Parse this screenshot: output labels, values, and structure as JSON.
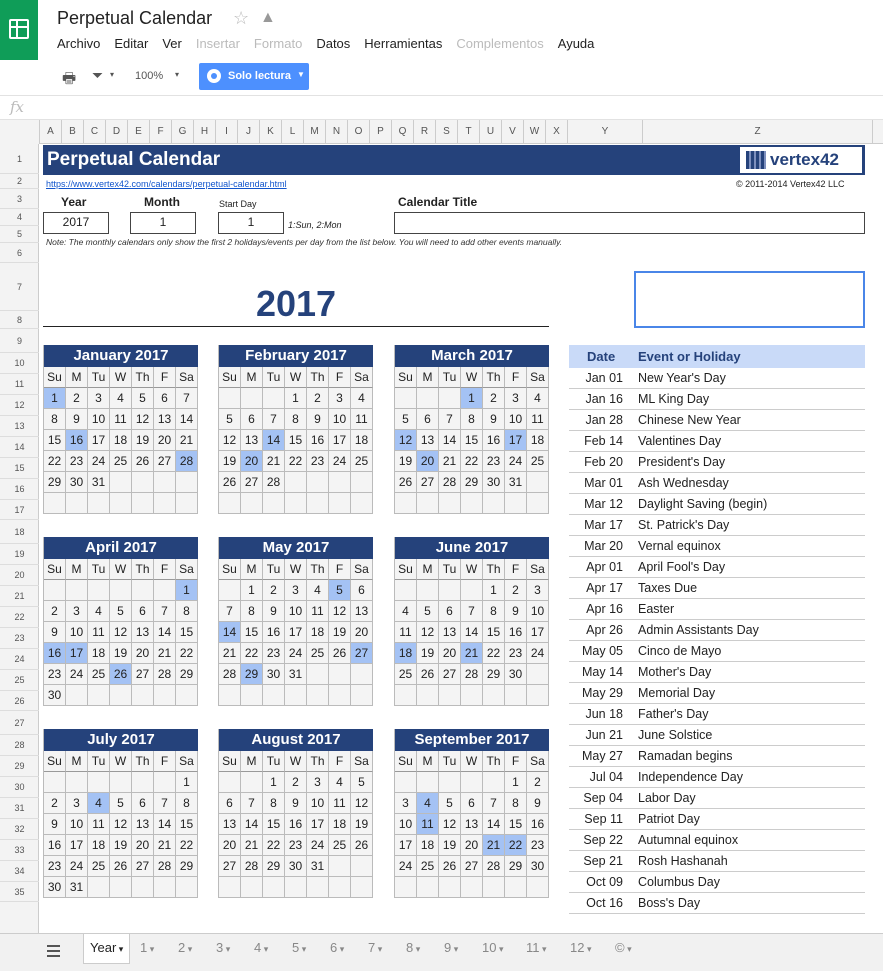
{
  "app": {
    "title": "Perpetual Calendar",
    "star_icon": "star-icon",
    "drive_icon": "drive-icon"
  },
  "menu": [
    {
      "label": "Archivo",
      "enabled": true
    },
    {
      "label": "Editar",
      "enabled": true
    },
    {
      "label": "Ver",
      "enabled": true
    },
    {
      "label": "Insertar",
      "enabled": false
    },
    {
      "label": "Formato",
      "enabled": false
    },
    {
      "label": "Datos",
      "enabled": true
    },
    {
      "label": "Herramientas",
      "enabled": true
    },
    {
      "label": "Complementos",
      "enabled": false
    },
    {
      "label": "Ayuda",
      "enabled": true
    }
  ],
  "toolbar": {
    "zoom": "100%",
    "readonly_label": "Solo lectura"
  },
  "formula": {
    "fx": "fx"
  },
  "columns": [
    "A",
    "B",
    "C",
    "D",
    "E",
    "F",
    "G",
    "H",
    "I",
    "J",
    "K",
    "L",
    "M",
    "N",
    "O",
    "P",
    "Q",
    "R",
    "S",
    "T",
    "U",
    "V",
    "W",
    "X",
    "Y",
    "Z"
  ],
  "rows": [
    "1",
    "2",
    "3",
    "4",
    "5",
    "6",
    "7",
    "8",
    "9",
    "10",
    "11",
    "12",
    "13",
    "14",
    "15",
    "16",
    "17",
    "18",
    "19",
    "20",
    "21",
    "22",
    "23",
    "24",
    "25",
    "26",
    "27",
    "28",
    "29",
    "30",
    "31",
    "32",
    "33",
    "34",
    "35"
  ],
  "sheet": {
    "title": "Perpetual Calendar",
    "logo_text": "vertex42",
    "link": "https://www.vertex42.com/calendars/perpetual-calendar.html",
    "copyright": "© 2011-2014 Vertex42 LLC",
    "year_label": "Year",
    "month_label": "Month",
    "startday_label": "Start Day",
    "caltitle_label": "Calendar Title",
    "year_value": "2017",
    "month_value": "1",
    "startday_value": "1",
    "startday_hint": "1:Sun, 2:Mon",
    "note": "Note: The monthly calendars only show the first 2 holidays/events per day from the list below. You will need to add other events manually.",
    "big_year": "2017"
  },
  "dow": [
    "Su",
    "M",
    "Tu",
    "W",
    "Th",
    "F",
    "Sa"
  ],
  "months": [
    {
      "name": "January 2017",
      "days": [
        "1",
        "2",
        "3",
        "4",
        "5",
        "6",
        "7",
        "8",
        "9",
        "10",
        "11",
        "12",
        "13",
        "14",
        "15",
        "16",
        "17",
        "18",
        "19",
        "20",
        "21",
        "22",
        "23",
        "24",
        "25",
        "26",
        "27",
        "28",
        "29",
        "30",
        "31",
        "",
        "",
        "",
        "",
        "",
        "",
        "",
        "",
        "",
        "",
        ""
      ],
      "hl": [
        0,
        15,
        27
      ]
    },
    {
      "name": "February 2017",
      "days": [
        "",
        "",
        "",
        "1",
        "2",
        "3",
        "4",
        "5",
        "6",
        "7",
        "8",
        "9",
        "10",
        "11",
        "12",
        "13",
        "14",
        "15",
        "16",
        "17",
        "18",
        "19",
        "20",
        "21",
        "22",
        "23",
        "24",
        "25",
        "26",
        "27",
        "28",
        "",
        "",
        "",
        "",
        "",
        "",
        "",
        "",
        "",
        "",
        ""
      ],
      "hl": [
        16,
        22
      ]
    },
    {
      "name": "March 2017",
      "days": [
        "",
        "",
        "",
        "1",
        "2",
        "3",
        "4",
        "5",
        "6",
        "7",
        "8",
        "9",
        "10",
        "11",
        "12",
        "13",
        "14",
        "15",
        "16",
        "17",
        "18",
        "19",
        "20",
        "21",
        "22",
        "23",
        "24",
        "25",
        "26",
        "27",
        "28",
        "29",
        "30",
        "31",
        "",
        "",
        "",
        "",
        "",
        "",
        "",
        ""
      ],
      "hl": [
        3,
        14,
        19,
        22
      ]
    },
    {
      "name": "April 2017",
      "days": [
        "",
        "",
        "",
        "",
        "",
        "",
        "1",
        "2",
        "3",
        "4",
        "5",
        "6",
        "7",
        "8",
        "9",
        "10",
        "11",
        "12",
        "13",
        "14",
        "15",
        "16",
        "17",
        "18",
        "19",
        "20",
        "21",
        "22",
        "23",
        "24",
        "25",
        "26",
        "27",
        "28",
        "29",
        "30",
        "",
        "",
        "",
        "",
        "",
        ""
      ],
      "hl": [
        6,
        21,
        22,
        31
      ]
    },
    {
      "name": "May 2017",
      "days": [
        "",
        "1",
        "2",
        "3",
        "4",
        "5",
        "6",
        "7",
        "8",
        "9",
        "10",
        "11",
        "12",
        "13",
        "14",
        "15",
        "16",
        "17",
        "18",
        "19",
        "20",
        "21",
        "22",
        "23",
        "24",
        "25",
        "26",
        "27",
        "28",
        "29",
        "30",
        "31",
        "",
        "",
        "",
        "",
        "",
        "",
        "",
        "",
        "",
        ""
      ],
      "hl": [
        5,
        14,
        27,
        29
      ]
    },
    {
      "name": "June 2017",
      "days": [
        "",
        "",
        "",
        "",
        "1",
        "2",
        "3",
        "4",
        "5",
        "6",
        "7",
        "8",
        "9",
        "10",
        "11",
        "12",
        "13",
        "14",
        "15",
        "16",
        "17",
        "18",
        "19",
        "20",
        "21",
        "22",
        "23",
        "24",
        "25",
        "26",
        "27",
        "28",
        "29",
        "30",
        "",
        "",
        "",
        "",
        "",
        "",
        "",
        ""
      ],
      "hl": [
        21,
        24
      ]
    },
    {
      "name": "July 2017",
      "days": [
        "",
        "",
        "",
        "",
        "",
        "",
        "1",
        "2",
        "3",
        "4",
        "5",
        "6",
        "7",
        "8",
        "9",
        "10",
        "11",
        "12",
        "13",
        "14",
        "15",
        "16",
        "17",
        "18",
        "19",
        "20",
        "21",
        "22",
        "23",
        "24",
        "25",
        "26",
        "27",
        "28",
        "29",
        "30",
        "31",
        "",
        "",
        "",
        "",
        ""
      ],
      "hl": [
        9
      ]
    },
    {
      "name": "August 2017",
      "days": [
        "",
        "",
        "1",
        "2",
        "3",
        "4",
        "5",
        "6",
        "7",
        "8",
        "9",
        "10",
        "11",
        "12",
        "13",
        "14",
        "15",
        "16",
        "17",
        "18",
        "19",
        "20",
        "21",
        "22",
        "23",
        "24",
        "25",
        "26",
        "27",
        "28",
        "29",
        "30",
        "31",
        "",
        "",
        "",
        "",
        "",
        "",
        "",
        "",
        ""
      ],
      "hl": []
    },
    {
      "name": "September 2017",
      "days": [
        "",
        "",
        "",
        "",
        "",
        "1",
        "2",
        "3",
        "4",
        "5",
        "6",
        "7",
        "8",
        "9",
        "10",
        "11",
        "12",
        "13",
        "14",
        "15",
        "16",
        "17",
        "18",
        "19",
        "20",
        "21",
        "22",
        "23",
        "24",
        "25",
        "26",
        "27",
        "28",
        "29",
        "30",
        "",
        "",
        "",
        "",
        "",
        "",
        ""
      ],
      "hl": [
        8,
        15,
        25,
        26
      ]
    }
  ],
  "events_header": {
    "date": "Date",
    "event": "Event or Holiday"
  },
  "events": [
    {
      "date": "Jan 01",
      "name": "New Year's Day"
    },
    {
      "date": "Jan 16",
      "name": "ML King Day"
    },
    {
      "date": "Jan 28",
      "name": "Chinese New Year"
    },
    {
      "date": "Feb 14",
      "name": "Valentines Day"
    },
    {
      "date": "Feb 20",
      "name": "President's Day"
    },
    {
      "date": "Mar 01",
      "name": "Ash Wednesday"
    },
    {
      "date": "Mar 12",
      "name": "Daylight Saving (begin)"
    },
    {
      "date": "Mar 17",
      "name": "St. Patrick's Day"
    },
    {
      "date": "Mar 20",
      "name": "Vernal equinox"
    },
    {
      "date": "Apr 01",
      "name": "April Fool's Day"
    },
    {
      "date": "Apr 17",
      "name": "Taxes Due"
    },
    {
      "date": "Apr 16",
      "name": "Easter"
    },
    {
      "date": "Apr 26",
      "name": "Admin Assistants Day"
    },
    {
      "date": "May 05",
      "name": "Cinco de Mayo"
    },
    {
      "date": "May 14",
      "name": "Mother's Day"
    },
    {
      "date": "May 29",
      "name": "Memorial Day"
    },
    {
      "date": "Jun 18",
      "name": "Father's Day"
    },
    {
      "date": "Jun 21",
      "name": "June Solstice"
    },
    {
      "date": "May 27",
      "name": "Ramadan begins"
    },
    {
      "date": "Jul 04",
      "name": "Independence Day"
    },
    {
      "date": "Sep 04",
      "name": "Labor Day"
    },
    {
      "date": "Sep 11",
      "name": "Patriot Day"
    },
    {
      "date": "Sep 22",
      "name": "Autumnal equinox"
    },
    {
      "date": "Sep 21",
      "name": "Rosh Hashanah"
    },
    {
      "date": "Oct 09",
      "name": "Columbus Day"
    },
    {
      "date": "Oct 16",
      "name": "Boss's Day"
    }
  ],
  "tabs": [
    "Year",
    "1",
    "2",
    "3",
    "4",
    "5",
    "6",
    "7",
    "8",
    "9",
    "10",
    "11",
    "12",
    "©"
  ]
}
